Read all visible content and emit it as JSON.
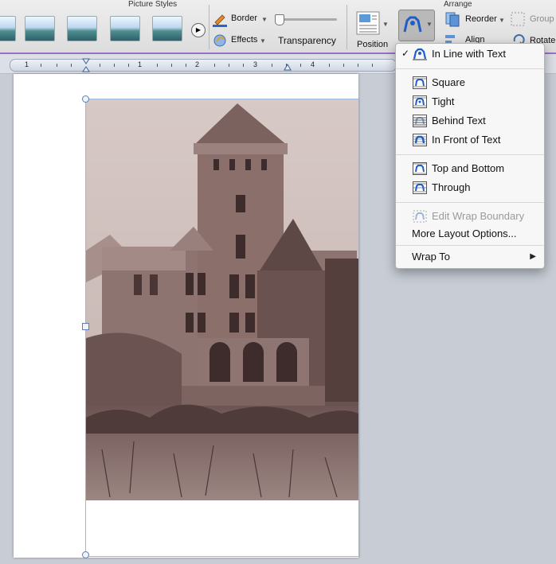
{
  "ribbon": {
    "picture_styles_title": "Picture Styles",
    "arrange_title": "Arrange",
    "border_label": "Border",
    "effects_label": "Effects",
    "transparency_label": "Transparency",
    "position_label": "Position",
    "reorder_label": "Reorder",
    "group_label": "Group",
    "align_label": "Align",
    "rotate_label": "Rotate"
  },
  "ruler": {
    "numbers": [
      "1",
      "1",
      "2",
      "3",
      "4"
    ]
  },
  "wrap_menu": {
    "items": [
      {
        "label": "In Line with Text",
        "checked": true
      },
      {
        "label": "Square"
      },
      {
        "label": "Tight"
      },
      {
        "label": "Behind Text"
      },
      {
        "label": "In Front of Text"
      },
      {
        "label": "Top and Bottom"
      },
      {
        "label": "Through"
      },
      {
        "label": "Edit Wrap Boundary",
        "disabled": true
      },
      {
        "label": "More Layout Options..."
      },
      {
        "label": "Wrap To"
      }
    ],
    "check_mark": "✓",
    "submenu_arrow": "▶"
  },
  "colors": {
    "accent": "#2b63c7",
    "photo_sepia": "#a48f8b"
  }
}
